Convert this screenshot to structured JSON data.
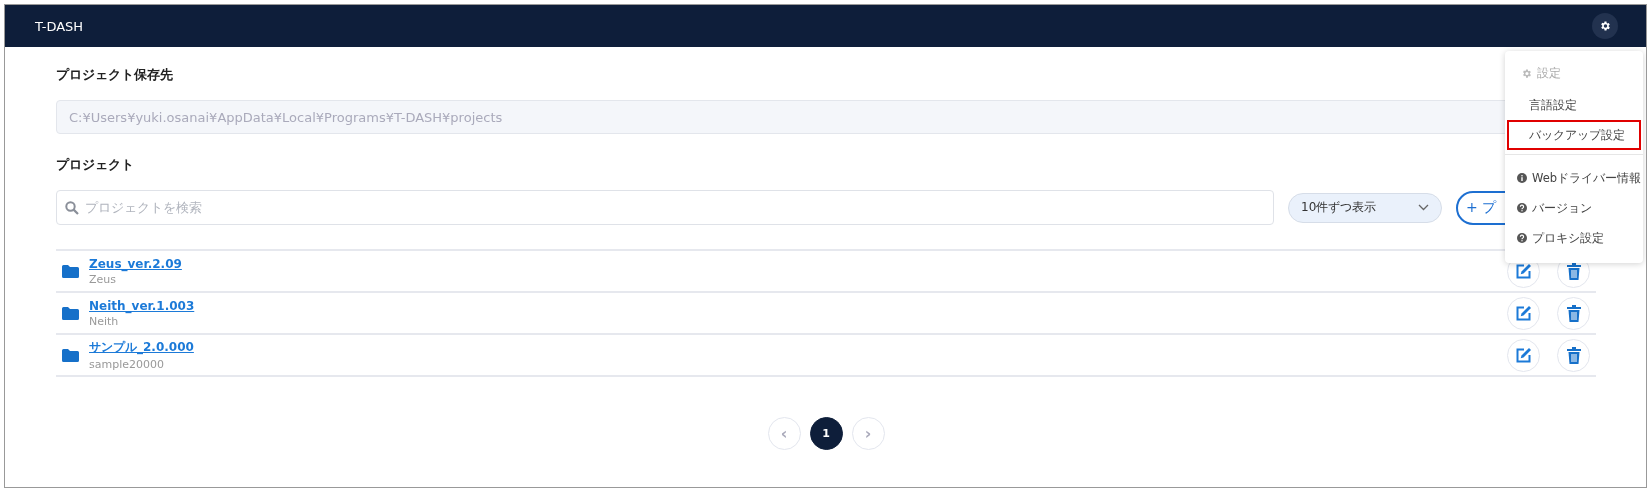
{
  "app": {
    "title": "T-DASH"
  },
  "storage": {
    "heading": "プロジェクト保存先",
    "path": "C:¥Users¥yuki.osanai¥AppData¥Local¥Programs¥T-DASH¥projects"
  },
  "projects": {
    "heading": "プロジェクト",
    "search": {
      "placeholder": "プロジェクトを検索"
    },
    "page_size": "10件ずつ表示",
    "add_button": "+ プ"
  },
  "rows": [
    {
      "name": "Zeus_ver.2.09",
      "description": "Zeus"
    },
    {
      "name": "Neith_ver.1.003",
      "description": "Neith"
    },
    {
      "name": "サンプル_2.0.000",
      "description": "sample20000"
    }
  ],
  "pagination": {
    "prev": "‹",
    "next": "›",
    "pages": [
      {
        "label": "1",
        "selected": true
      }
    ]
  },
  "settings_menu": {
    "title": "設定",
    "items": [
      {
        "label": "言語設定",
        "kind": "plain",
        "highlighted": false
      },
      {
        "label": "バックアップ設定",
        "kind": "plain",
        "highlighted": true
      },
      {
        "label": "Webドライバー情報",
        "kind": "info",
        "highlighted": false
      },
      {
        "label": "バージョン",
        "kind": "question",
        "highlighted": false
      },
      {
        "label": "プロキシ設定",
        "kind": "question",
        "highlighted": false
      }
    ]
  }
}
